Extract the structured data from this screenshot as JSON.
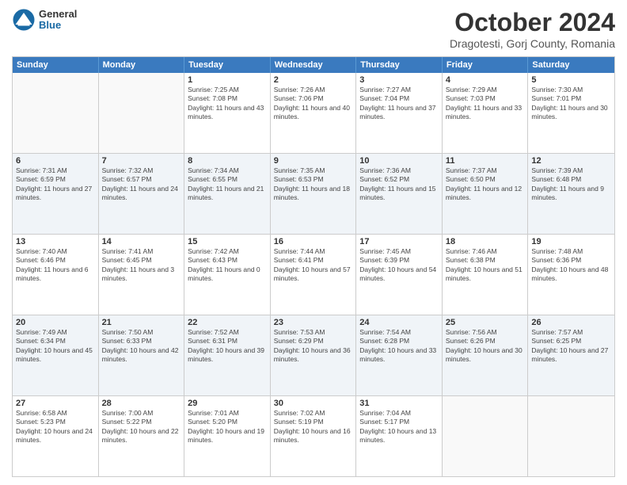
{
  "header": {
    "logo_general": "General",
    "logo_blue": "Blue",
    "month_title": "October 2024",
    "location": "Dragotesti, Gorj County, Romania"
  },
  "calendar": {
    "days_of_week": [
      "Sunday",
      "Monday",
      "Tuesday",
      "Wednesday",
      "Thursday",
      "Friday",
      "Saturday"
    ],
    "rows": [
      [
        {
          "day": "",
          "empty": true
        },
        {
          "day": "",
          "empty": true
        },
        {
          "day": "1",
          "sunrise": "Sunrise: 7:25 AM",
          "sunset": "Sunset: 7:08 PM",
          "daylight": "Daylight: 11 hours and 43 minutes."
        },
        {
          "day": "2",
          "sunrise": "Sunrise: 7:26 AM",
          "sunset": "Sunset: 7:06 PM",
          "daylight": "Daylight: 11 hours and 40 minutes."
        },
        {
          "day": "3",
          "sunrise": "Sunrise: 7:27 AM",
          "sunset": "Sunset: 7:04 PM",
          "daylight": "Daylight: 11 hours and 37 minutes."
        },
        {
          "day": "4",
          "sunrise": "Sunrise: 7:29 AM",
          "sunset": "Sunset: 7:03 PM",
          "daylight": "Daylight: 11 hours and 33 minutes."
        },
        {
          "day": "5",
          "sunrise": "Sunrise: 7:30 AM",
          "sunset": "Sunset: 7:01 PM",
          "daylight": "Daylight: 11 hours and 30 minutes."
        }
      ],
      [
        {
          "day": "6",
          "sunrise": "Sunrise: 7:31 AM",
          "sunset": "Sunset: 6:59 PM",
          "daylight": "Daylight: 11 hours and 27 minutes."
        },
        {
          "day": "7",
          "sunrise": "Sunrise: 7:32 AM",
          "sunset": "Sunset: 6:57 PM",
          "daylight": "Daylight: 11 hours and 24 minutes."
        },
        {
          "day": "8",
          "sunrise": "Sunrise: 7:34 AM",
          "sunset": "Sunset: 6:55 PM",
          "daylight": "Daylight: 11 hours and 21 minutes."
        },
        {
          "day": "9",
          "sunrise": "Sunrise: 7:35 AM",
          "sunset": "Sunset: 6:53 PM",
          "daylight": "Daylight: 11 hours and 18 minutes."
        },
        {
          "day": "10",
          "sunrise": "Sunrise: 7:36 AM",
          "sunset": "Sunset: 6:52 PM",
          "daylight": "Daylight: 11 hours and 15 minutes."
        },
        {
          "day": "11",
          "sunrise": "Sunrise: 7:37 AM",
          "sunset": "Sunset: 6:50 PM",
          "daylight": "Daylight: 11 hours and 12 minutes."
        },
        {
          "day": "12",
          "sunrise": "Sunrise: 7:39 AM",
          "sunset": "Sunset: 6:48 PM",
          "daylight": "Daylight: 11 hours and 9 minutes."
        }
      ],
      [
        {
          "day": "13",
          "sunrise": "Sunrise: 7:40 AM",
          "sunset": "Sunset: 6:46 PM",
          "daylight": "Daylight: 11 hours and 6 minutes."
        },
        {
          "day": "14",
          "sunrise": "Sunrise: 7:41 AM",
          "sunset": "Sunset: 6:45 PM",
          "daylight": "Daylight: 11 hours and 3 minutes."
        },
        {
          "day": "15",
          "sunrise": "Sunrise: 7:42 AM",
          "sunset": "Sunset: 6:43 PM",
          "daylight": "Daylight: 11 hours and 0 minutes."
        },
        {
          "day": "16",
          "sunrise": "Sunrise: 7:44 AM",
          "sunset": "Sunset: 6:41 PM",
          "daylight": "Daylight: 10 hours and 57 minutes."
        },
        {
          "day": "17",
          "sunrise": "Sunrise: 7:45 AM",
          "sunset": "Sunset: 6:39 PM",
          "daylight": "Daylight: 10 hours and 54 minutes."
        },
        {
          "day": "18",
          "sunrise": "Sunrise: 7:46 AM",
          "sunset": "Sunset: 6:38 PM",
          "daylight": "Daylight: 10 hours and 51 minutes."
        },
        {
          "day": "19",
          "sunrise": "Sunrise: 7:48 AM",
          "sunset": "Sunset: 6:36 PM",
          "daylight": "Daylight: 10 hours and 48 minutes."
        }
      ],
      [
        {
          "day": "20",
          "sunrise": "Sunrise: 7:49 AM",
          "sunset": "Sunset: 6:34 PM",
          "daylight": "Daylight: 10 hours and 45 minutes."
        },
        {
          "day": "21",
          "sunrise": "Sunrise: 7:50 AM",
          "sunset": "Sunset: 6:33 PM",
          "daylight": "Daylight: 10 hours and 42 minutes."
        },
        {
          "day": "22",
          "sunrise": "Sunrise: 7:52 AM",
          "sunset": "Sunset: 6:31 PM",
          "daylight": "Daylight: 10 hours and 39 minutes."
        },
        {
          "day": "23",
          "sunrise": "Sunrise: 7:53 AM",
          "sunset": "Sunset: 6:29 PM",
          "daylight": "Daylight: 10 hours and 36 minutes."
        },
        {
          "day": "24",
          "sunrise": "Sunrise: 7:54 AM",
          "sunset": "Sunset: 6:28 PM",
          "daylight": "Daylight: 10 hours and 33 minutes."
        },
        {
          "day": "25",
          "sunrise": "Sunrise: 7:56 AM",
          "sunset": "Sunset: 6:26 PM",
          "daylight": "Daylight: 10 hours and 30 minutes."
        },
        {
          "day": "26",
          "sunrise": "Sunrise: 7:57 AM",
          "sunset": "Sunset: 6:25 PM",
          "daylight": "Daylight: 10 hours and 27 minutes."
        }
      ],
      [
        {
          "day": "27",
          "sunrise": "Sunrise: 6:58 AM",
          "sunset": "Sunset: 5:23 PM",
          "daylight": "Daylight: 10 hours and 24 minutes."
        },
        {
          "day": "28",
          "sunrise": "Sunrise: 7:00 AM",
          "sunset": "Sunset: 5:22 PM",
          "daylight": "Daylight: 10 hours and 22 minutes."
        },
        {
          "day": "29",
          "sunrise": "Sunrise: 7:01 AM",
          "sunset": "Sunset: 5:20 PM",
          "daylight": "Daylight: 10 hours and 19 minutes."
        },
        {
          "day": "30",
          "sunrise": "Sunrise: 7:02 AM",
          "sunset": "Sunset: 5:19 PM",
          "daylight": "Daylight: 10 hours and 16 minutes."
        },
        {
          "day": "31",
          "sunrise": "Sunrise: 7:04 AM",
          "sunset": "Sunset: 5:17 PM",
          "daylight": "Daylight: 10 hours and 13 minutes."
        },
        {
          "day": "",
          "empty": true
        },
        {
          "day": "",
          "empty": true
        }
      ]
    ]
  }
}
